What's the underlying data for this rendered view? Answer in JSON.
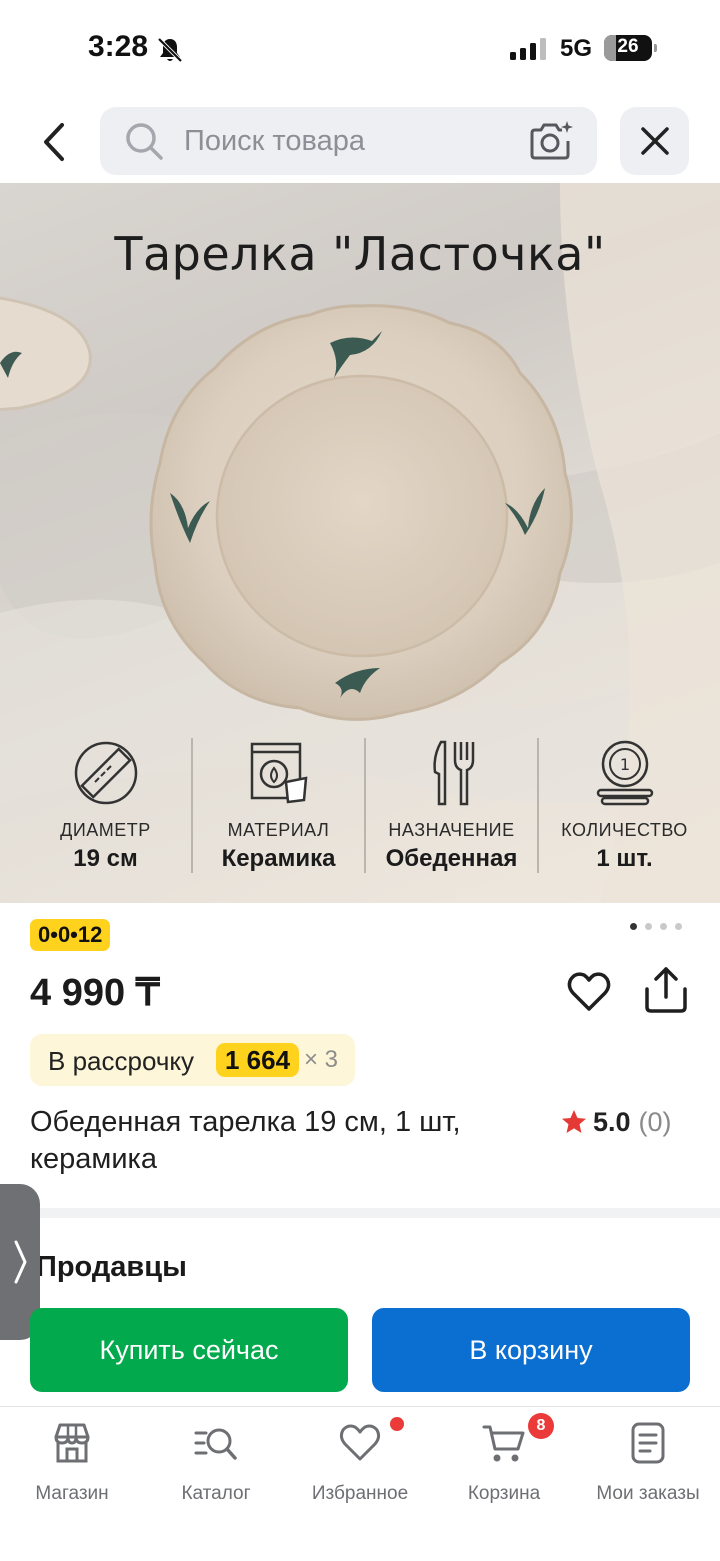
{
  "status_bar": {
    "time": "3:28",
    "network": "5G",
    "battery_level": "26",
    "battery_fraction": 0.26
  },
  "header": {
    "search_placeholder": "Поиск товара",
    "icons": [
      "chevron-left-icon",
      "search-icon",
      "camera-icon",
      "close-icon"
    ]
  },
  "product_image": {
    "title": "Тарелка \"Ласточка\"",
    "features": [
      {
        "label": "ДИАМЕТР",
        "value": "19 см",
        "icon": "ruler-icon"
      },
      {
        "label": "МАТЕРИАЛ",
        "value": "Керамика",
        "icon": "kiln-icon"
      },
      {
        "label": "НАЗНАЧЕНИЕ",
        "value": "Обеденная",
        "icon": "fork-knife-icon"
      },
      {
        "label": "КОЛИЧЕСТВО",
        "value": "1 шт.",
        "icon": "plate-stack-icon"
      }
    ],
    "pager": {
      "count": 4,
      "active_index": 0
    }
  },
  "product": {
    "timer": "0•0•12",
    "price": "4 990 ₸",
    "installment": {
      "label": "В рассрочку",
      "amount": "1 664",
      "times": "× 3"
    },
    "title": "Обеденная тарелка 19 см, 1 шт, керамика",
    "rating": {
      "value": "5.0",
      "count": "(0)"
    }
  },
  "sellers": {
    "title": "Продавцы"
  },
  "actions": {
    "buy_now": "Купить сейчас",
    "add_to_cart": "В корзину"
  },
  "colors": {
    "buy_now": "#02a94d",
    "add_to_cart": "#0a6fd1",
    "badge_yellow": "#ffd21d",
    "notification_red": "#ea3a3a"
  },
  "bottom_nav": {
    "items": [
      {
        "label": "Магазин",
        "icon": "store-icon"
      },
      {
        "label": "Каталог",
        "icon": "catalog-search-icon"
      },
      {
        "label": "Избранное",
        "icon": "heart-icon"
      },
      {
        "label": "Корзина",
        "icon": "cart-icon"
      },
      {
        "label": "Мои заказы",
        "icon": "orders-icon"
      }
    ],
    "cart_badge": "8"
  }
}
